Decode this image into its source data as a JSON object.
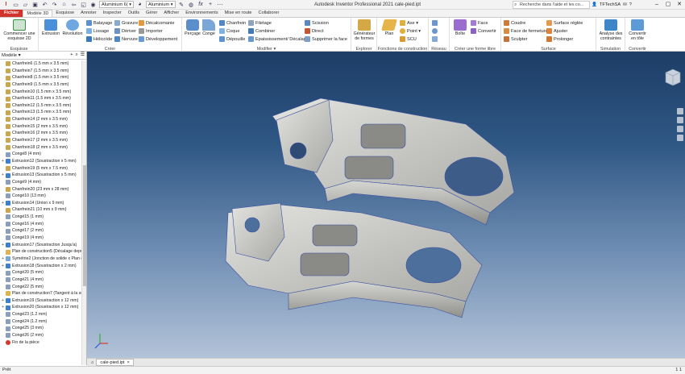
{
  "window": {
    "title": "Autodesk Inventor Professional 2021    cale-pied.ipt",
    "search_placeholder": "Recherche dans l'aide et les co...",
    "user": "TFTechSA"
  },
  "qat": {
    "material": "Aluminium 6(",
    "appearance": "Aluminium"
  },
  "tabs": [
    "Fichier",
    "Modèle 3D",
    "Esquisse",
    "Annoter",
    "Inspecter",
    "Outils",
    "Gérer",
    "Afficher",
    "Environnements",
    "Mise en route",
    "Collaborer"
  ],
  "ribbon": {
    "esquisse": {
      "big": "Commencer une esquisse 2D",
      "title": "Esquisse"
    },
    "creer": {
      "extrusion": "Extrusion",
      "revolution": "Révolution",
      "balayage": "Balayage",
      "lissage": "Lissage",
      "helicoide": "Hélicoïde",
      "gravure": "Gravure",
      "deriver": "Dériver",
      "nervure": "Nervure",
      "decalcomanie": "Décalcomanie",
      "importer": "Importer",
      "developpement": "Développement",
      "title": "Créer"
    },
    "modifier": {
      "percage": "Perçage",
      "conge": "Congé",
      "chanfrein": "Chanfrein",
      "coque": "Coque",
      "depouille": "Dépouille",
      "filetage": "Filetage",
      "combiner": "Combiner",
      "epaississement": "Epaississement/ Décalage",
      "scission": "Scission",
      "direct": "Direct",
      "supprimer": "Supprimer la face",
      "title": "Modifier ▾"
    },
    "explorer": {
      "big": "Générateur de formes",
      "title": "Explorer"
    },
    "fonctions": {
      "plan": "Plan",
      "axe": "Axe ▾",
      "point": "Point ▾",
      "scu": "SCU",
      "title": "Fonctions de construction"
    },
    "reseau": {
      "title": "Réseau"
    },
    "forme_libre": {
      "boite": "Boîte",
      "face": "Face",
      "convertir": "Convertir",
      "title": "Créer une forme libre"
    },
    "surface": {
      "coudre": "Coudre",
      "face_fermeture": "Face de fermeture",
      "sculpter": "Sculpter",
      "surface_reglee": "Surface réglée",
      "ajuster": "Ajuster",
      "prolonger": "Prolonger",
      "title": "Surface"
    },
    "simulation": {
      "big": "Analyse des contraintes",
      "title": "Simulation"
    },
    "convertir": {
      "big": "Convertir en tôle",
      "title": "Convertir"
    }
  },
  "browser": {
    "title": "Modèle ▾",
    "items": [
      {
        "label": "Chanfrein6 (1.5 mm x 3.5 mm)",
        "icon": "ch"
      },
      {
        "label": "Chanfrein7 (1.5 mm x 3.5 mm)",
        "icon": "ch"
      },
      {
        "label": "Chanfrein8 (1.5 mm x 3.5 mm)",
        "icon": "ch"
      },
      {
        "label": "Chanfrein9 (1.5 mm x 3.5 mm)",
        "icon": "ch"
      },
      {
        "label": "Chanfrein10 (1.5 mm x 3.5 mm)",
        "icon": "ch"
      },
      {
        "label": "Chanfrein11 (1.5 mm x 3.5 mm)",
        "icon": "ch"
      },
      {
        "label": "Chanfrein12 (1.5 mm x 3.5 mm)",
        "icon": "ch"
      },
      {
        "label": "Chanfrein13 (1.5 mm x 3.5 mm)",
        "icon": "ch"
      },
      {
        "label": "Chanfrein14 (2 mm x 3.5 mm)",
        "icon": "ch"
      },
      {
        "label": "Chanfrein15 (2 mm x 3.5 mm)",
        "icon": "ch"
      },
      {
        "label": "Chanfrein16 (2 mm x 3.5 mm)",
        "icon": "ch"
      },
      {
        "label": "Chanfrein17 (2 mm x 3.5 mm)",
        "icon": "ch"
      },
      {
        "label": "Chanfrein18 (2 mm x 3.5 mm)",
        "icon": "ch"
      },
      {
        "label": "Congé8 (4 mm)",
        "icon": "co"
      },
      {
        "label": "Extrusion12 (Soustraction x 5 mm)",
        "icon": "ex",
        "expand": true
      },
      {
        "label": "Chanfrein19 (5 mm x 7.5 mm)",
        "icon": "ch"
      },
      {
        "label": "Extrusion13 (Soustraction x 5 mm)",
        "icon": "ex",
        "expand": true
      },
      {
        "label": "Congé9 (4 mm)",
        "icon": "co"
      },
      {
        "label": "Chanfrein20 (23 mm x 28 mm)",
        "icon": "ch"
      },
      {
        "label": "Congé10 (13 mm)",
        "icon": "co"
      },
      {
        "label": "Extrusion14 (Union x 9 mm)",
        "icon": "ex",
        "expand": true
      },
      {
        "label": "Chanfrein21 (10 mm x 9 mm)",
        "icon": "ch"
      },
      {
        "label": "Congé15 (1 mm)",
        "icon": "co"
      },
      {
        "label": "Congé16 (4 mm)",
        "icon": "co"
      },
      {
        "label": "Congé17 (2 mm)",
        "icon": "co"
      },
      {
        "label": "Congé19 (4 mm)",
        "icon": "co"
      },
      {
        "label": "Extrusion17 (Soustraction Jusqu'a)",
        "icon": "ex",
        "expand": true
      },
      {
        "label": "Plan de construction5 (Décalage depuis",
        "icon": "pl"
      },
      {
        "label": "Symétrie2 (Jonction de solide x Plan de",
        "icon": "sy",
        "expand": true
      },
      {
        "label": "Extrusion18 (Soustraction x 2 mm)",
        "icon": "ex",
        "expand": true
      },
      {
        "label": "Congé20 (5 mm)",
        "icon": "co"
      },
      {
        "label": "Congé21 (4 mm)",
        "icon": "co"
      },
      {
        "label": "Congé22 (5 mm)",
        "icon": "co"
      },
      {
        "label": "Plan de construction7 (Tangent à la sur",
        "icon": "pl"
      },
      {
        "label": "Extrusion19 (Soustraction x 12 mm)",
        "icon": "ex",
        "expand": true
      },
      {
        "label": "Extrusion20 (Soustraction x 12 mm)",
        "icon": "ex",
        "expand": true
      },
      {
        "label": "Congé23 (1.2 mm)",
        "icon": "co"
      },
      {
        "label": "Congé24 (1.2 mm)",
        "icon": "co"
      },
      {
        "label": "Congé25 (3 mm)",
        "icon": "co"
      },
      {
        "label": "Congé26 (2 mm)",
        "icon": "co"
      },
      {
        "label": "Fin de la pièce",
        "icon": "end"
      }
    ]
  },
  "document_tab": "cale-pied.ipt",
  "status": {
    "left": "Prêt",
    "right": "1  1"
  }
}
